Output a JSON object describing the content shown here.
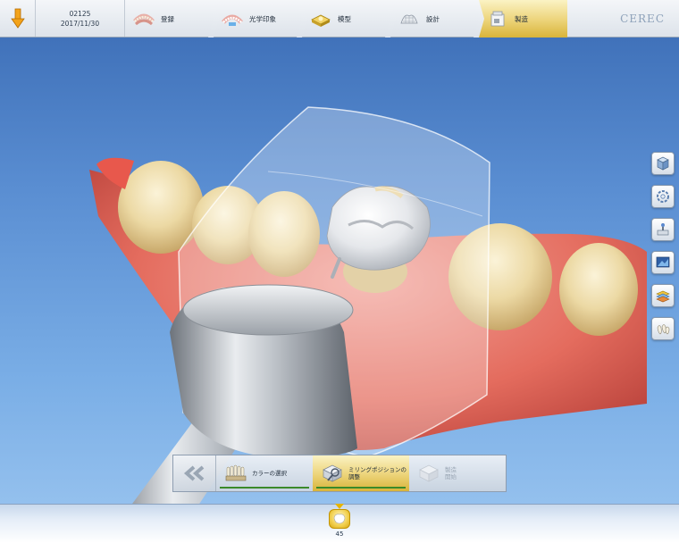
{
  "case": {
    "id": "02125",
    "date": "2017/11/30"
  },
  "brand": "CEREC",
  "workflow_steps": [
    {
      "label": "登録",
      "icon": "jaw-arch-icon",
      "active": false
    },
    {
      "label": "光学印象",
      "icon": "scan-arch-icon",
      "active": false
    },
    {
      "label": "模型",
      "icon": "model-box-icon",
      "active": false
    },
    {
      "label": "設計",
      "icon": "design-mesh-icon",
      "active": false
    },
    {
      "label": "製造",
      "icon": "milling-unit-icon",
      "active": true
    }
  ],
  "right_tools": [
    {
      "icon": "view-cube-icon"
    },
    {
      "icon": "rotate-ring-icon"
    },
    {
      "icon": "tool-settings-icon"
    },
    {
      "icon": "screenshot-icon"
    },
    {
      "icon": "layers-icon"
    },
    {
      "icon": "teeth-view-icon"
    }
  ],
  "substeps": {
    "back_icon": "double-chevron-left-icon",
    "items": [
      {
        "label_line1": "カラーの選択",
        "label_line2": "",
        "icon": "shade-guide-icon",
        "active": false,
        "disabled": false
      },
      {
        "label_line1": "ミリングポジションの",
        "label_line2": "調整",
        "icon": "milling-position-icon",
        "active": true,
        "disabled": false
      },
      {
        "label_line1": "製造",
        "label_line2": "開始",
        "icon": "start-milling-icon",
        "active": false,
        "disabled": true
      }
    ]
  },
  "restoration": {
    "number": "45",
    "icon": "crown-tooth-icon"
  },
  "colors": {
    "accent_gold": "#e3c45a",
    "progress_green": "#3a8a2a",
    "background_blue": "#5a8ed2"
  }
}
